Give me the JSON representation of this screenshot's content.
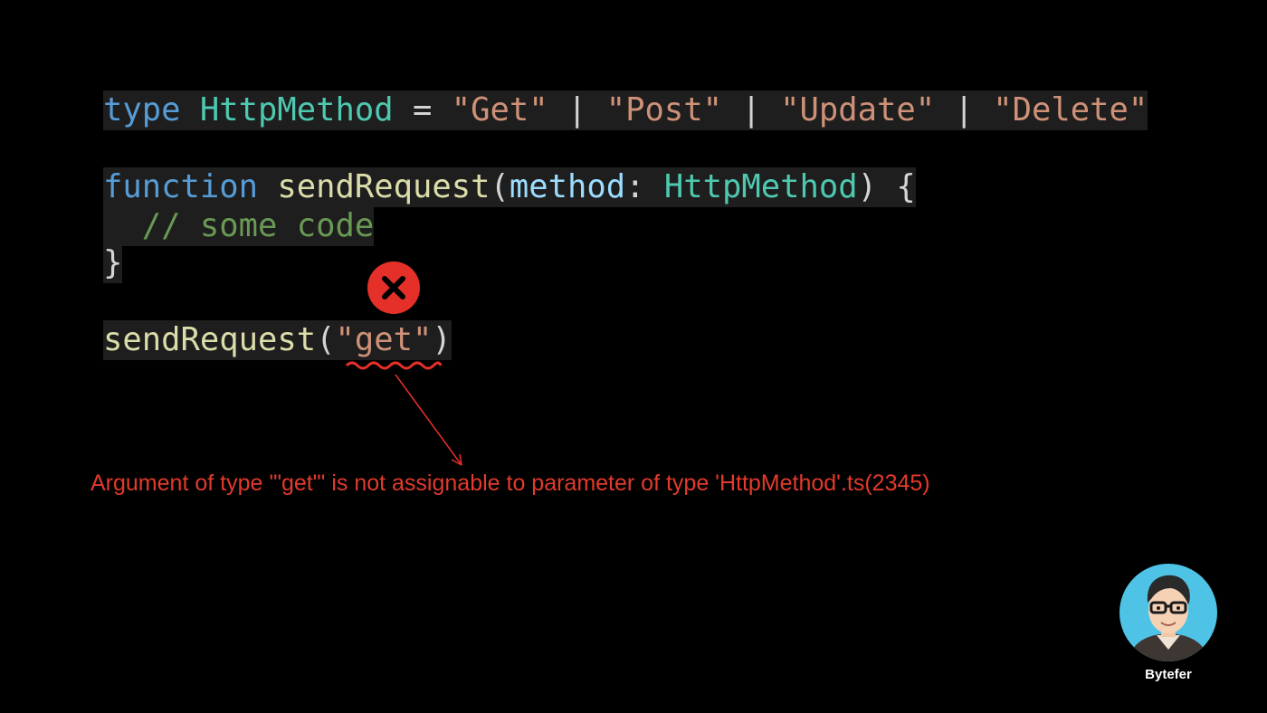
{
  "code": {
    "line1": {
      "kw": "type",
      "space1": " ",
      "type_name": "HttpMethod",
      "eq": " = ",
      "s1": "\"Get\"",
      "sep1": " | ",
      "s2": "\"Post\"",
      "sep2": " | ",
      "s3": "\"Update\"",
      "sep3": " | ",
      "s4": "\"Delete\""
    },
    "line2": {
      "kw": "function",
      "space1": " ",
      "fn_name": "sendRequest",
      "open": "(",
      "param": "method",
      "colon": ": ",
      "param_type": "HttpMethod",
      "close": ") {"
    },
    "line3": {
      "indent": "  ",
      "comment": "// some code"
    },
    "line4": {
      "brace": "}"
    },
    "line5": {
      "fn_name": "sendRequest",
      "open": "(",
      "arg": "\"get\"",
      "close": ")"
    }
  },
  "error": {
    "message": "Argument of type '\"get\"' is not assignable to parameter of type 'HttpMethod'.ts(2345)",
    "color": "#e23a2c"
  },
  "brand": {
    "name": "Bytefer"
  },
  "icons": {
    "error": "error-x-icon",
    "avatar": "avatar-icon"
  }
}
